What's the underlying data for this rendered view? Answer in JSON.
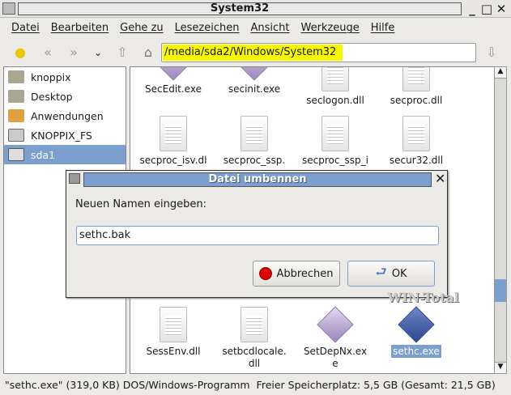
{
  "window": {
    "title": "System32"
  },
  "menu": [
    "Datei",
    "Bearbeiten",
    "Gehe zu",
    "Lesezeichen",
    "Ansicht",
    "Werkzeuge",
    "Hilfe"
  ],
  "location": {
    "path": "/media/sda2/Windows/System32"
  },
  "sidebar": [
    {
      "label": "knoppix",
      "icon": "home-folder-icon"
    },
    {
      "label": "Desktop",
      "icon": "desktop-folder-icon"
    },
    {
      "label": "Anwendungen",
      "icon": "applications-icon"
    },
    {
      "label": "KNOPPIX_FS",
      "icon": "drive-icon"
    },
    {
      "label": "sda1",
      "icon": "drive-icon",
      "selected": true
    }
  ],
  "files": [
    {
      "name": "SecEdit.exe",
      "type": "exe"
    },
    {
      "name": "secinit.exe",
      "type": "exe"
    },
    {
      "name": "seclogon.dll",
      "type": "doc"
    },
    {
      "name": "secproc.dll",
      "type": "doc"
    },
    {
      "name": "secproc_isv.dl",
      "type": "doc"
    },
    {
      "name": "secproc_ssp.",
      "type": "doc"
    },
    {
      "name": "secproc_ssp_i",
      "type": "doc"
    },
    {
      "name": "secur32.dll",
      "type": "doc"
    },
    {
      "name": "SessEnv.dll",
      "type": "doc"
    },
    {
      "name": "setbcdlocale.\ndll",
      "type": "doc"
    },
    {
      "name": "SetDepNx.ex\ne",
      "type": "exe"
    },
    {
      "name": "sethc.exe",
      "type": "exe",
      "selected": true
    }
  ],
  "status": "\"sethc.exe\" (319,0 KB) DOS/Windows-Programm  Freier Speicherplatz: 5,5 GB (Gesamt: 21,5 GB)",
  "dialog": {
    "title": "Datei umbennen",
    "prompt": "Neuen Namen eingeben:",
    "value": "sethc.bak",
    "cancel": "Abbrechen",
    "ok": "OK"
  },
  "watermark": "WIN-Total",
  "colors": {
    "selection": "#7b9fcf",
    "location_highlight": "#f7f700"
  }
}
